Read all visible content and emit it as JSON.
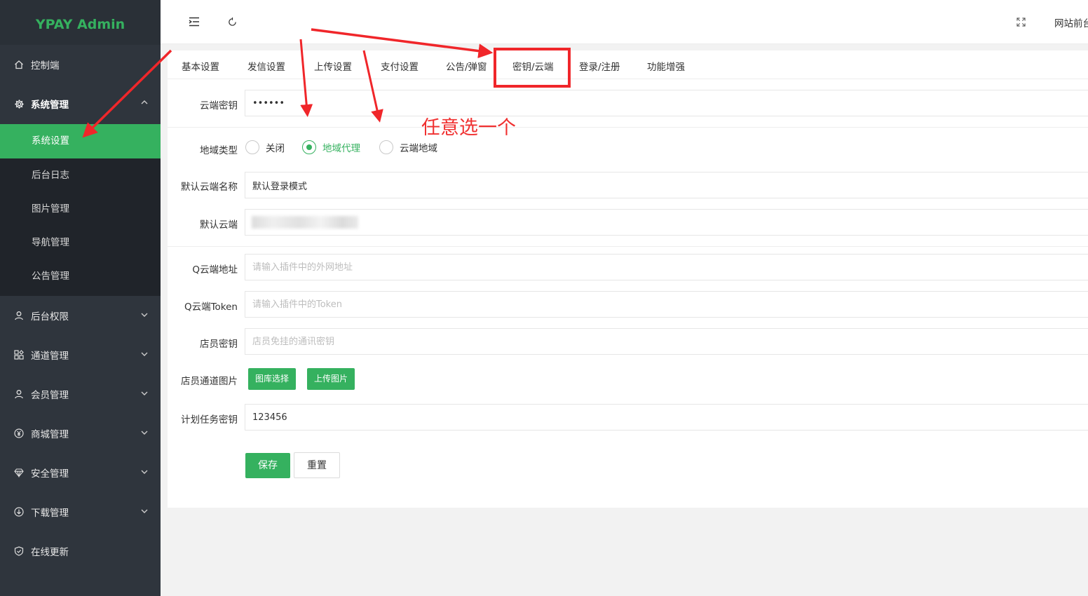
{
  "sidebar": {
    "logo": "YPAY Admin",
    "items": [
      {
        "label": "控制端",
        "icon": "home-icon"
      },
      {
        "label": "系统管理",
        "icon": "gear-icon",
        "open": true,
        "children": [
          {
            "label": "系统设置",
            "active": true
          },
          {
            "label": "后台日志"
          },
          {
            "label": "图片管理"
          },
          {
            "label": "导航管理"
          },
          {
            "label": "公告管理"
          }
        ]
      },
      {
        "label": "后台权限",
        "icon": "user-icon"
      },
      {
        "label": "通道管理",
        "icon": "apps-icon"
      },
      {
        "label": "会员管理",
        "icon": "user-icon"
      },
      {
        "label": "商城管理",
        "icon": "yen-icon"
      },
      {
        "label": "安全管理",
        "icon": "diamond-icon"
      },
      {
        "label": "下载管理",
        "icon": "download-icon"
      },
      {
        "label": "在线更新",
        "icon": "shield-check-icon"
      }
    ]
  },
  "header": {
    "frontend_link": "网站前台"
  },
  "tabs": [
    {
      "label": "基本设置"
    },
    {
      "label": "发信设置"
    },
    {
      "label": "上传设置"
    },
    {
      "label": "支付设置"
    },
    {
      "label": "公告/弹窗"
    },
    {
      "label": "密钥/云端",
      "active": true
    },
    {
      "label": "登录/注册"
    },
    {
      "label": "功能增强"
    }
  ],
  "form": {
    "cloud_key": {
      "label": "云端密钥",
      "value": "••••••"
    },
    "region_type": {
      "label": "地域类型",
      "options": [
        "关闭",
        "地域代理",
        "云端地域"
      ],
      "selected": "地域代理"
    },
    "default_cloud_name": {
      "label": "默认云端名称",
      "value": "默认登录模式"
    },
    "default_cloud": {
      "label": "默认云端",
      "value": ""
    },
    "q_cloud_address": {
      "label": "Q云端地址",
      "placeholder": "请输入插件中的外网地址"
    },
    "q_cloud_token": {
      "label": "Q云端Token",
      "placeholder": "请输入插件中的Token"
    },
    "clerk_key": {
      "label": "店员密钥",
      "placeholder": "店员免挂的通讯密钥"
    },
    "clerk_channel_image": {
      "label": "店员通道图片",
      "gallery_button": "图库选择",
      "upload_button": "上传图片"
    },
    "cron_key": {
      "label": "计划任务密钥",
      "value": "123456"
    },
    "save_button": "保存",
    "reset_button": "重置"
  },
  "annotation": {
    "text": "任意选一个",
    "color": "#f03030"
  },
  "colors": {
    "accent": "#35b15f",
    "sidebar_bg": "#2f353d",
    "submenu_bg": "#20242a",
    "annotation_red": "#f0262a"
  }
}
